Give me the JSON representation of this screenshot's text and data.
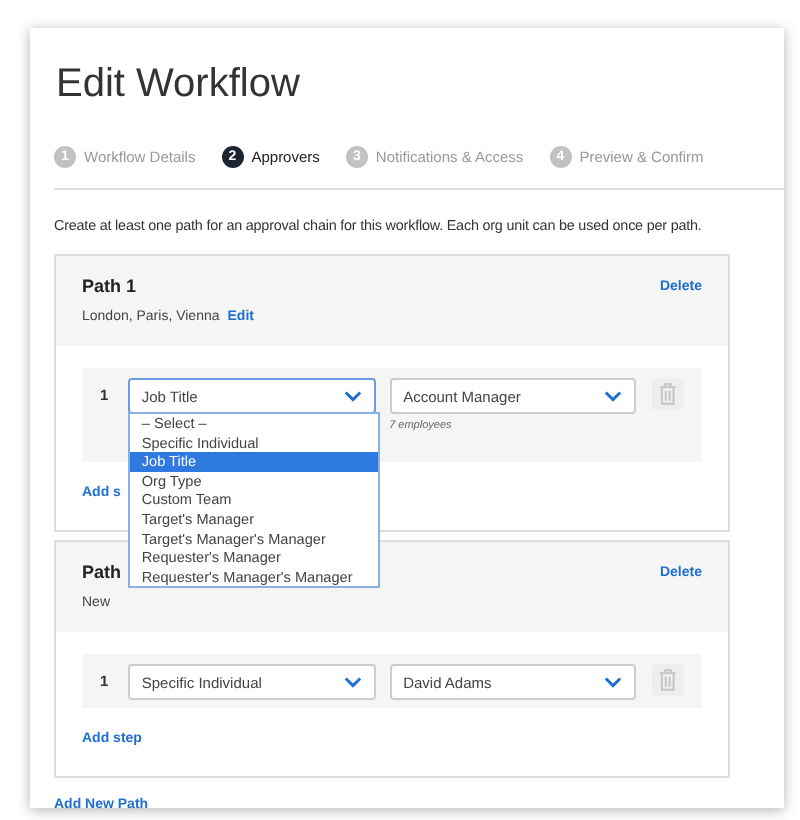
{
  "title": "Edit Workflow",
  "steps": [
    {
      "number": "1",
      "label": "Workflow Details",
      "selected": false
    },
    {
      "number": "2",
      "label": "Approvers",
      "selected": true
    },
    {
      "number": "3",
      "label": "Notifications & Access",
      "selected": false
    },
    {
      "number": "4",
      "label": "Preview & Confirm",
      "selected": false
    }
  ],
  "instructions": "Create at least one path for an approval chain for this workflow. Each org unit can be used once per path.",
  "paths": [
    {
      "title": "Path 1",
      "locations": "London, Paris, Vienna",
      "edit_link": "Edit",
      "delete_link": "Delete",
      "add_step": "Add s",
      "open_dropdown": true,
      "steps": [
        {
          "number": "1",
          "type_select": "Job Title",
          "value_select": "Account Manager",
          "note": "7 employees",
          "focused": true
        }
      ]
    },
    {
      "title": "Path",
      "locations": "New",
      "delete_link": "Delete",
      "add_step": "Add step",
      "open_dropdown": false,
      "steps": [
        {
          "number": "1",
          "type_select": "Specific Individual",
          "value_select": "David Adams",
          "focused": false
        }
      ]
    }
  ],
  "dropdown": {
    "options": [
      {
        "label": "– Select –",
        "selected": false
      },
      {
        "label": "Specific Individual",
        "selected": false
      },
      {
        "label": "Job Title",
        "selected": true
      },
      {
        "label": "Org Type",
        "selected": false
      },
      {
        "label": "Custom Team",
        "selected": false
      },
      {
        "label": "Target's Manager",
        "selected": false
      },
      {
        "label": "Target's Manager's Manager",
        "selected": false
      },
      {
        "label": "Requester's Manager",
        "selected": false
      },
      {
        "label": "Requester's Manager's Manager",
        "selected": false
      }
    ]
  },
  "add_path": "Add New Path"
}
